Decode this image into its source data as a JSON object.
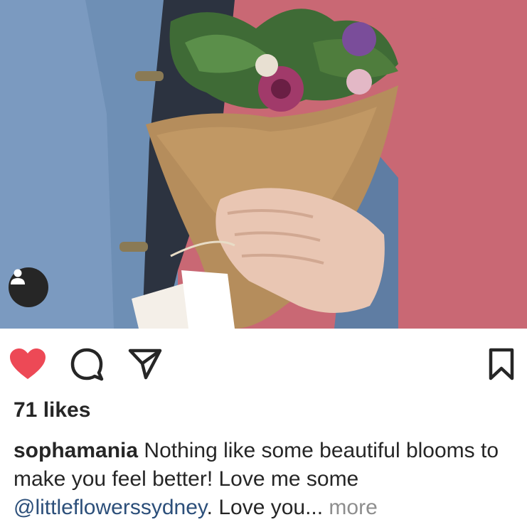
{
  "post": {
    "photo_description_icon": "photo",
    "likes_text": "71 likes",
    "caption": {
      "username": "sophamania",
      "text_part1": " Nothing like some beautiful blooms to make you feel better! Love me some ",
      "mention": "@littleflowerssydney",
      "text_part2": ". Love you...",
      "more_label": " more"
    }
  },
  "icons": {
    "like": "heart-icon",
    "comment": "comment-icon",
    "share": "send-icon",
    "save": "bookmark-icon",
    "user_tag": "person-icon"
  },
  "colors": {
    "like_active": "#ed4956",
    "mention": "#2c4f7a",
    "more": "#8e8e8e",
    "text": "#262626"
  }
}
